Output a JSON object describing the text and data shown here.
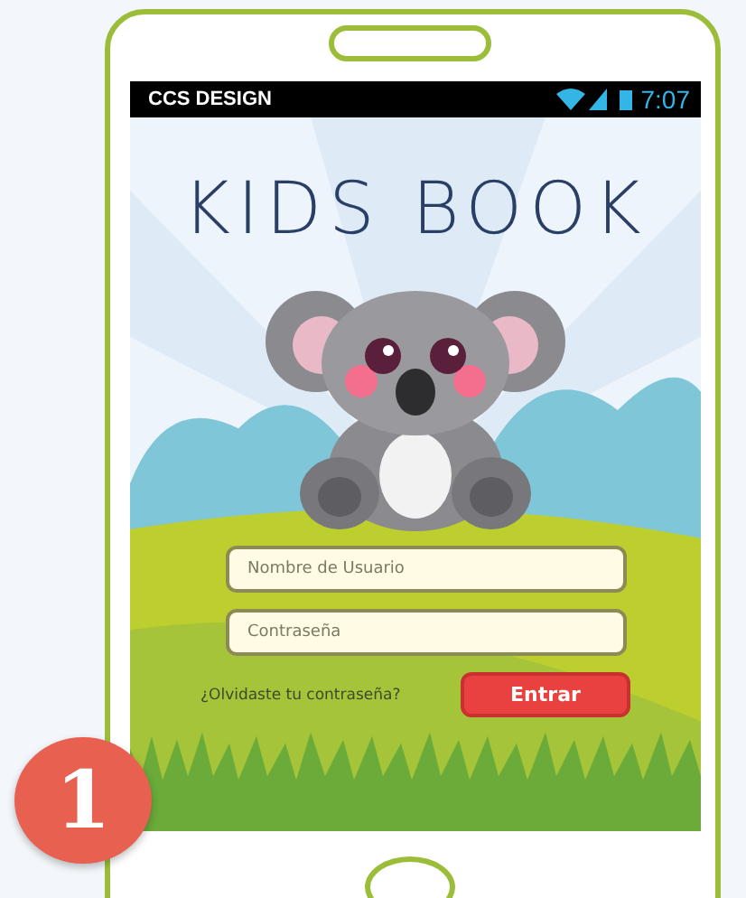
{
  "status_bar": {
    "title": "CCS DESIGN",
    "time": "7:07"
  },
  "app": {
    "title": "KIDS BOOK"
  },
  "form": {
    "username": {
      "placeholder": "Nombre de Usuario"
    },
    "password": {
      "placeholder": "Contraseña"
    },
    "forgot_link": "¿Olvidaste tu contraseña?",
    "submit_button": "Entrar"
  },
  "step_badge": "1"
}
